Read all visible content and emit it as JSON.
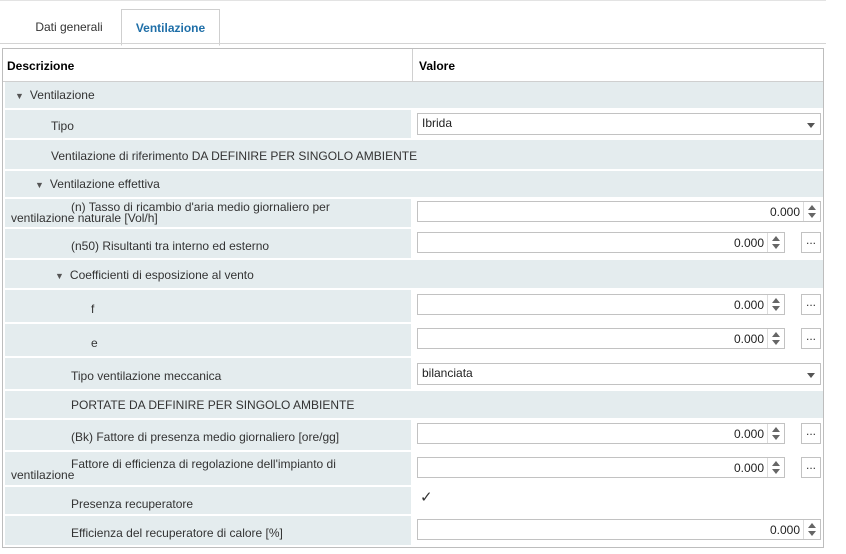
{
  "tabs": [
    {
      "label": "Dati generali",
      "active": false
    },
    {
      "label": "Ventilazione",
      "active": true
    }
  ],
  "grid": {
    "columns": {
      "description": "Descrizione",
      "value": "Valore"
    },
    "rows": {
      "ventilazione_group": "Ventilazione",
      "tipo_label": "Tipo",
      "tipo_value": "Ibrida",
      "riferimento_note": "Ventilazione di riferimento DA DEFINIRE PER SINGOLO AMBIENTE",
      "effettiva_group": "Ventilazione effettiva",
      "tasso_label_1": "(n) Tasso di ricambio d'aria medio giornaliero per",
      "tasso_label_2": "ventilazione naturale [Vol/h]",
      "tasso_value": "0.000",
      "n50_label": "(n50) Risultanti tra interno ed esterno",
      "n50_value": "0.000",
      "coeff_group": "Coefficienti di esposizione al vento",
      "f_label": "f",
      "f_value": "0.000",
      "e_label": "e",
      "e_value": "0.000",
      "tipo_mecc_label": "Tipo ventilazione meccanica",
      "tipo_mecc_value": "bilanciata",
      "portate_note": "PORTATE DA DEFINIRE PER SINGOLO AMBIENTE",
      "bk_label": "(Bk) Fattore di presenza medio giornaliero [ore/gg]",
      "bk_value": "0.000",
      "efficienza_reg_label_1": "Fattore di efficienza di regolazione dell'impianto di",
      "efficienza_reg_label_2": "ventilazione",
      "efficienza_reg_value": "0.000",
      "recuperatore_label": "Presenza recuperatore",
      "recuperatore_checked": true,
      "recuperatore_mark": "✓",
      "eff_recup_label": "Efficienza del recuperatore di calore [%]",
      "eff_recup_value": "0.000"
    },
    "ellipsis": "..."
  }
}
